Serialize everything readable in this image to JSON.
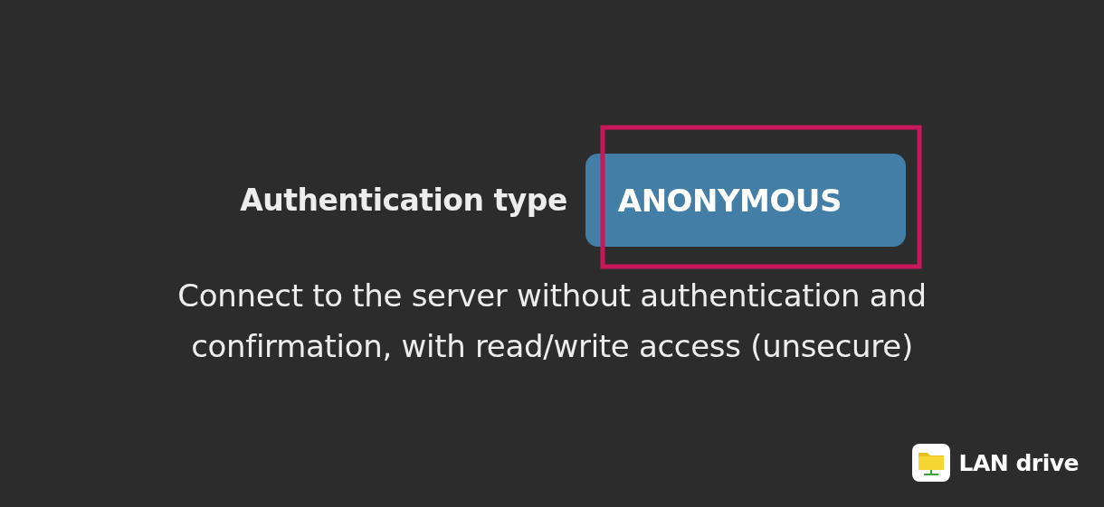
{
  "setting": {
    "label": "Authentication type",
    "value": "ANONYMOUS",
    "highlighted": true
  },
  "description": "Connect to the server without authentication and confirmation, with read/write access (unsecure)",
  "branding": {
    "app_name": "LAN drive"
  }
}
